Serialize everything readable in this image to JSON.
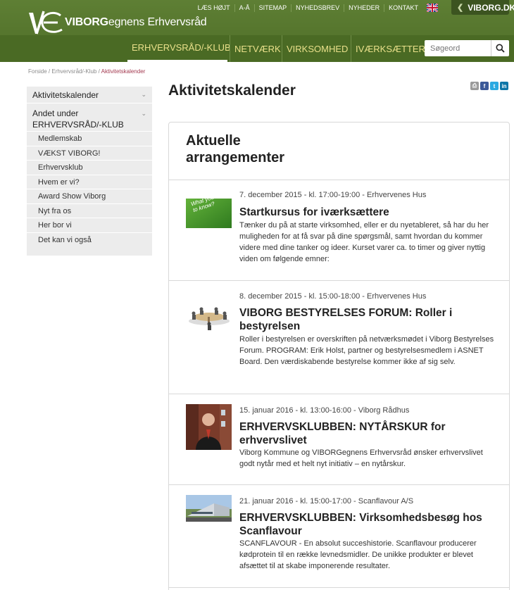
{
  "header": {
    "logo_text_bold": "VIBORG",
    "logo_text_rest": "egnens Erhvervsråd",
    "utility_links": [
      "LÆS HØJT",
      "A-Å",
      "SITEMAP",
      "NYHEDSBREV",
      "NYHEDER",
      "KONTAKT"
    ],
    "viborg_button": "VIBORG.DK",
    "nav": [
      "ERHVERVSRÅD/-KLUB",
      "NETVÆRK",
      "VIRKSOMHED",
      "IVÆRKSÆTTER"
    ],
    "search_placeholder": "Søgeord"
  },
  "breadcrumb": {
    "items": [
      "Forside",
      "Erhvervsråd/-Klub"
    ],
    "current": "Aktivitetskalender"
  },
  "sidebar": {
    "top_items": [
      "Aktivitetskalender",
      "Andet under ERHVERVSRÅD/-KLUB"
    ],
    "sub_items": [
      "Medlemskab",
      "VÆKST VIBORG!",
      "Erhvervsklub",
      "Hvem er vi?",
      "Award Show Viborg",
      "Nyt fra os",
      "Her bor vi",
      "Det kan vi også"
    ]
  },
  "main": {
    "title": "Aktivitetskalender",
    "card_title": "Aktuelle arrangementer",
    "events": [
      {
        "date": "7. december 2015 - kl. 17:00-19:00 - Erhvervenes Hus",
        "title": "Startkursus for iværksættere",
        "desc": "Tænker du på at starte virksomhed, eller er du nyetableret, så har du her muligheden for at få svar på dine spørgsmål, samt hvordan du kommer videre med dine tanker og ideer. Kurset varer ca. to timer og giver nyttig viden om følgende emner:",
        "thumb_text": "What you need to know?"
      },
      {
        "date": "8. december 2015 - kl. 15:00-18:00 - Erhvervenes Hus",
        "title": "VIBORG BESTYRELSES FORUM: Roller i bestyrelsen",
        "desc": "Roller i bestyrelsen er overskriften på netværksmødet i Viborg Bestyrelses Forum. PROGRAM: Erik Holst, partner og bestyrelsesmedlem i ASNET Board. Den værdiskabende bestyrelse kommer ikke af sig selv."
      },
      {
        "date": "15. januar 2016 - kl. 13:00-16:00 - Viborg Rådhus",
        "title": "ERHVERVSKLUBBEN: NYTÅRSKUR for erhvervslivet",
        "desc": "Viborg Kommune og VIBORGegnens Erhvervsråd ønsker erhvervslivet godt nytår med et helt nyt initiativ – en nytårskur."
      },
      {
        "date": "21. januar 2016 - kl. 15:00-17:00 - Scanflavour A/S",
        "title": "ERHVERVSKLUBBEN: Virksomhedsbesøg hos Scanflavour",
        "desc": "SCANFLAVOUR - En absolut succeshistorie. Scanflavour producerer kødprotein til en række levnedsmidler. De unikke produkter er blevet afsættet til at skabe imponerende resultater."
      }
    ]
  },
  "colors": {
    "header_green": "#5e7f34",
    "nav_green": "#4a6a24",
    "nav_text": "#e9e08a",
    "breadcrumb_current": "#a33a50"
  }
}
